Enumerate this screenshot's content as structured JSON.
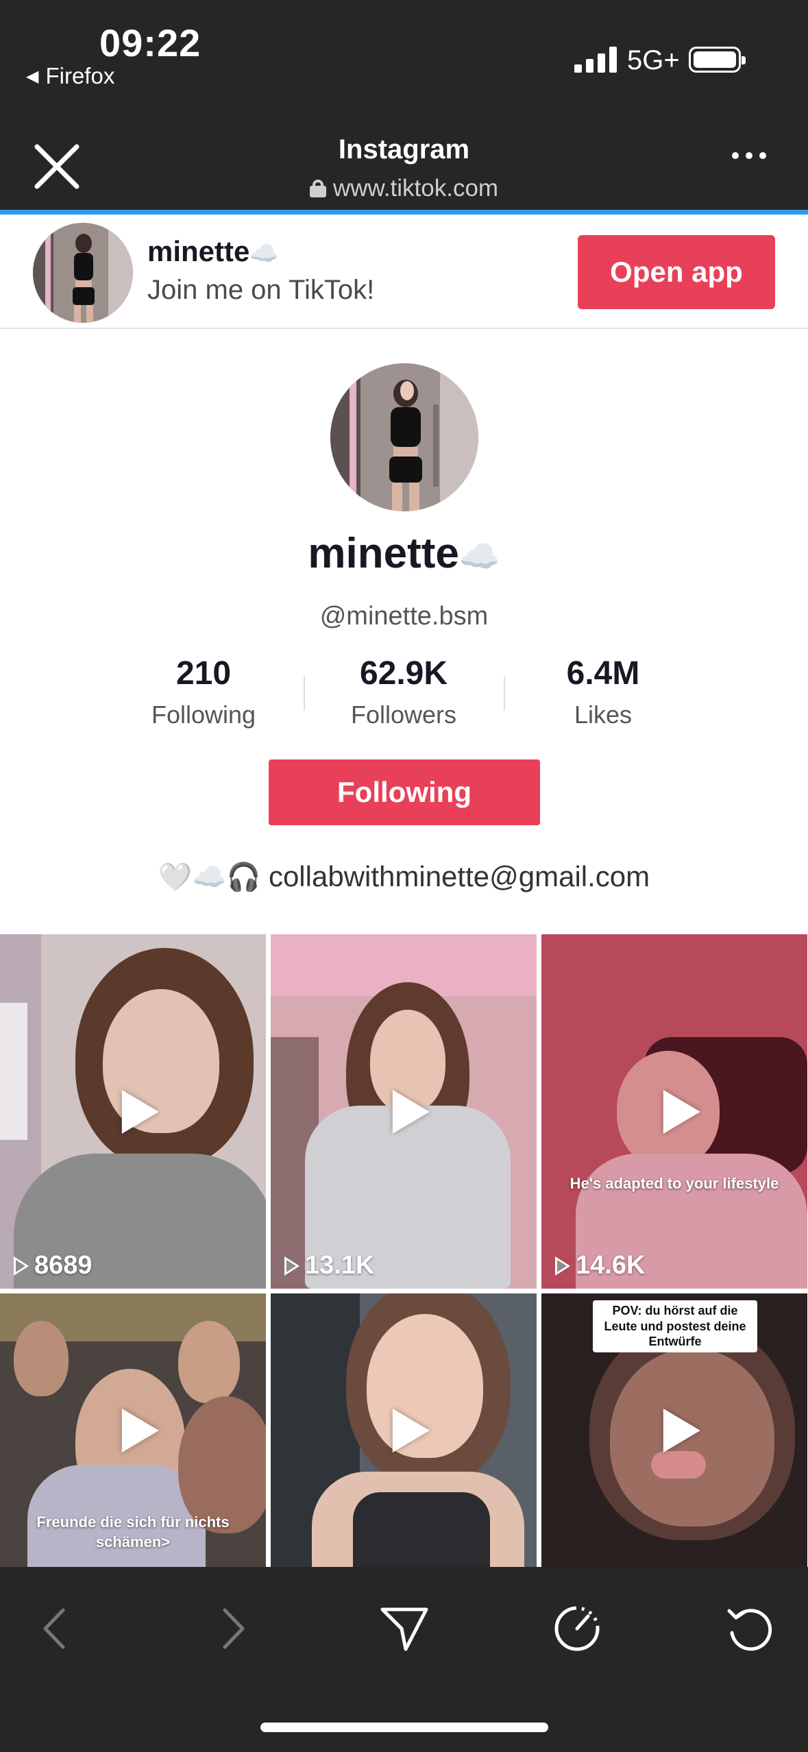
{
  "status_bar": {
    "time": "09:22",
    "back_app": "Firefox",
    "network": "5G+"
  },
  "browser": {
    "title": "Instagram",
    "url": "www.tiktok.com",
    "icons": {
      "close": "close-icon",
      "more": "more-icon",
      "lock": "lock-icon"
    }
  },
  "banner": {
    "name": "minette",
    "name_emoji": "☁️",
    "subtitle": "Join me on TikTok!",
    "open_app_label": "Open app"
  },
  "profile": {
    "display_name": "minette",
    "name_emoji": "☁️",
    "handle": "@minette.bsm",
    "stats": [
      {
        "value": "210",
        "label": "Following"
      },
      {
        "value": "62.9K",
        "label": "Followers"
      },
      {
        "value": "6.4M",
        "label": "Likes"
      }
    ],
    "follow_button_label": "Following",
    "bio_emojis": "🤍☁️🎧",
    "bio_text": "collabwithminette@gmail.com"
  },
  "videos": [
    {
      "views": "8689",
      "caption": ""
    },
    {
      "views": "13.1K",
      "caption": ""
    },
    {
      "views": "14.6K",
      "caption": "He's adapted to your lifestyle"
    },
    {
      "views": "",
      "caption": "Freunde die sich für nichts schämen>"
    },
    {
      "views": "",
      "caption": ""
    },
    {
      "views": "",
      "caption": "",
      "sticker": "POV: du hörst auf die Leute und postest deine Entwürfe"
    }
  ],
  "toolbar": {
    "icons": [
      "back-icon",
      "forward-icon",
      "share-icon",
      "speed-icon",
      "reload-icon"
    ]
  },
  "colors": {
    "brand": "#e9405a",
    "chrome": "#262626",
    "progress": "#2d9bf0"
  }
}
